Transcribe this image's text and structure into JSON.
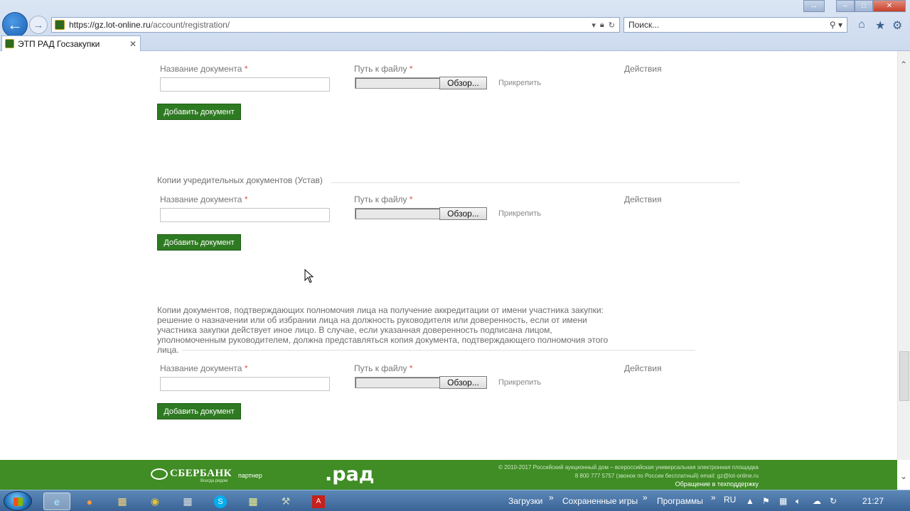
{
  "browser": {
    "url_host": "https://gz.lot-online.ru",
    "url_path": "/account/registration/",
    "search_placeholder": "Поиск...",
    "tab_title": "ЭТП РАД Госзакупки"
  },
  "columns": {
    "doc_name": "Название документа",
    "file_path": "Путь к файлу",
    "required_mark": "*",
    "actions": "Действия",
    "browse": "Обзор...",
    "attach": "Прикрепить",
    "add_document": "Добавить документ"
  },
  "sections": [
    {
      "title": ""
    },
    {
      "title": "Копии учредительных документов (Устав)"
    },
    {
      "title_lines": [
        "Копии документов, подтверждающих полномочия лица на получение аккредитации от имени участника закупки:",
        "решение о назначении или об избрании лица на должность руководителя или доверенность, если от имени",
        "участника закупки действует иное лицо. В случае, если указанная доверенность подписана лицом,",
        "уполномоченным руководителем, должна представляться копия документа, подтверждающего полномочия этого",
        "лица."
      ]
    }
  ],
  "footer": {
    "sber_name": "СБЕРБАНК",
    "sber_tagline": "Всегда рядом",
    "partner": "партнер",
    "rad": ".рад",
    "copyright": "© 2010-2017 Российский аукционный дом – всероссийская универсальная электронная площадка",
    "contacts": "8 800 777 5757 (звонок по России бесплатный) email: gz@lot-online.ru",
    "support": "Обращение в техподдержку"
  },
  "taskbar": {
    "downloads": "Загрузки",
    "saved_games": "Сохраненные игры",
    "programs": "Программы",
    "lang": "RU",
    "time": "21:27"
  }
}
